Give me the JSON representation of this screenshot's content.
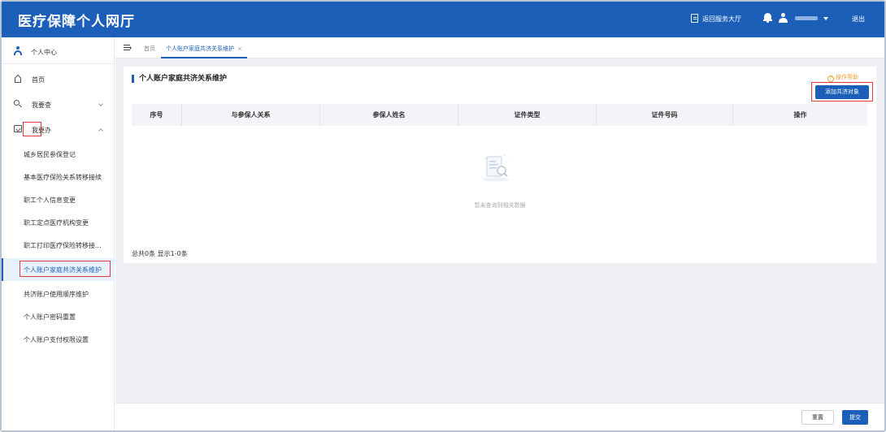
{
  "app": {
    "title": "医疗保障个人网厅"
  },
  "header": {
    "return_hall": "返回服务大厅",
    "logout": "退出"
  },
  "sidebar": {
    "header_label": "个人中心",
    "items": [
      {
        "label": "首页",
        "icon": "home-icon"
      },
      {
        "label": "我要查",
        "icon": "search-icon"
      },
      {
        "label": "我要办",
        "icon": "folder-icon"
      }
    ],
    "sub_items": [
      {
        "label": "城乡居民参保登记"
      },
      {
        "label": "基本医疗保险关系转移接续"
      },
      {
        "label": "职工个人信息变更"
      },
      {
        "label": "职工定点医疗机构变更"
      },
      {
        "label": "职工打印医疗保险转移接..."
      },
      {
        "label": "个人账户家庭共济关系维护"
      },
      {
        "label": "共济账户使用顺序维护"
      },
      {
        "label": "个人账户密码重置"
      },
      {
        "label": "个人账户支付权限设置"
      }
    ]
  },
  "tabs": {
    "home": "首页",
    "active": "个人账户家庭共济关系维护",
    "close": "×"
  },
  "card": {
    "title": "个人账户家庭共济关系维护",
    "help": "操作帮助",
    "add_button": "添加共济对象",
    "columns": [
      "序号",
      "与参保人关系",
      "参保人姓名",
      "证件类型",
      "证件号码",
      "操作"
    ],
    "empty_text": "暂未查询到相关数据",
    "total": "总共0条 显示1-0条"
  },
  "footer": {
    "reset": "重置",
    "submit": "提交"
  },
  "colors": {
    "primary": "#1b5fb8",
    "highlight": "#e0393e",
    "help": "#f0a030"
  }
}
